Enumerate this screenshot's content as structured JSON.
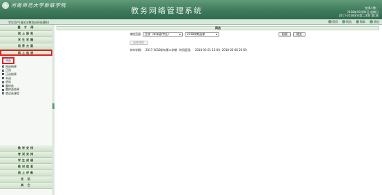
{
  "colors": {
    "header": "#3f7a5c",
    "sidebar": "#f5f8f4",
    "highlight": "#e02020",
    "link": "#0b3e8a"
  },
  "header": {
    "school_name": "河南师范大学新联学院",
    "system_title": "教务网络管理系统",
    "user_line1": "在线人数：",
    "user_line2": "2018年03月04日 星期日",
    "user_line3": "2017-2018学年第二学期 第1周"
  },
  "subbar": {
    "breadcrumb": "学生用户(请关注教务处网站通知)",
    "tools": [
      {
        "icon": "home-icon",
        "label": "首页"
      },
      {
        "icon": "message-icon",
        "label": "短信"
      },
      {
        "icon": "help-icon",
        "label": "帮助"
      },
      {
        "icon": "logout-icon",
        "label": "退出"
      }
    ]
  },
  "sidebar": {
    "top_menus": [
      "整 才 网",
      "网上报到",
      "学生学籍",
      "培养方案",
      "网上选课"
    ],
    "active_index": 4,
    "sub_head": "网选",
    "sub_items": [
      "网选结果",
      "正选",
      "正选结果",
      "补选",
      "退选",
      "重修选",
      "重修选结果",
      "就读选课程"
    ],
    "lower_menus": [
      "教学安排",
      "考试安排",
      "学生成绩",
      "教材信息",
      "网上评教",
      "论 坛",
      "其 它"
    ]
  },
  "main": {
    "panel_title": "网选",
    "course_range_label": "课程范围",
    "course_range_value": "主修（本年级/专业）",
    "category_value": "2018学期选课",
    "search_button": "检索",
    "submit_button": "提交",
    "select_button": "选择课程",
    "term_label": "学年学期：",
    "term_value": "2017-2018学年第二学期",
    "time_label": "时间区段：",
    "time_value": "2018-03-01 15:00--2018-03-06 23:59"
  }
}
